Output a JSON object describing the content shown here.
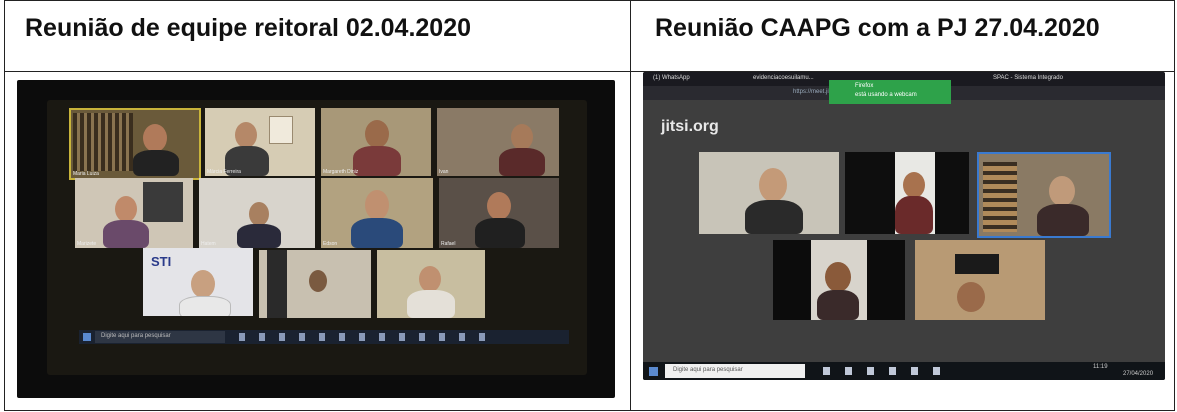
{
  "table": {
    "left": {
      "heading": "Reunião de equipe reitoral 02.04.2020",
      "participants": [
        "Maria Luiza",
        "Márcia Ferreira",
        "Margareth Diniz",
        "Ivan",
        "Marizete",
        "Hatem",
        "Edson",
        "Rafael"
      ],
      "sti_label": "STI",
      "search_placeholder": "Digite aqui para pesquisar"
    },
    "right": {
      "heading": "Reunião CAAPG com a PJ 27.04.2020",
      "tabs": [
        "(1) WhatsApp",
        "evidenciacoesuilamu...",
        "SPAC - Sistema Integrado"
      ],
      "url": "https://meet.jit.si/Evide",
      "popup_title": "Firefox",
      "popup_text": "está usando a webcam",
      "logo_text": "jitsi.org",
      "search_placeholder": "Digite aqui para pesquisar",
      "clock": "11:19",
      "date": "27/04/2020"
    }
  }
}
